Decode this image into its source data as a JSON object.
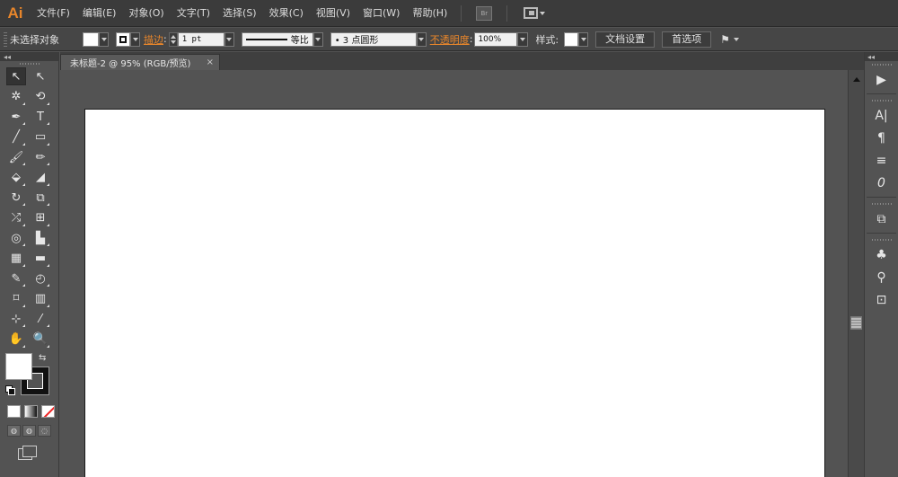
{
  "app": {
    "logo": "Ai"
  },
  "menu": {
    "items": [
      "文件(F)",
      "编辑(E)",
      "对象(O)",
      "文字(T)",
      "选择(S)",
      "效果(C)",
      "视图(V)",
      "窗口(W)",
      "帮助(H)"
    ],
    "bridge_label": "Br"
  },
  "control": {
    "selection_label": "未选择对象",
    "stroke_link": "描边",
    "stroke_weight": "1 pt",
    "stroke_profile": "等比",
    "brush": "• 3 点圆形",
    "opacity_link": "不透明度",
    "opacity_value": "100%",
    "style_label": "样式:",
    "doc_setup_button": "文档设置",
    "preferences_button": "首选项"
  },
  "document": {
    "tab_title": "未标题-2 @ 95% (RGB/预览)",
    "tab_close": "×"
  },
  "tools": {
    "rows": [
      [
        "↖",
        "↖"
      ],
      [
        "✲",
        "⟲"
      ],
      [
        "✒",
        "T"
      ],
      [
        "╱",
        "▭"
      ],
      [
        "🖌",
        "✏"
      ],
      [
        "⬙",
        "◢"
      ],
      [
        "↻",
        "⧉"
      ],
      [
        "⤮",
        "⊞"
      ],
      [
        "◎",
        "▙"
      ],
      [
        "▦",
        "▬"
      ],
      [
        "✎",
        "◴"
      ],
      [
        "⌑",
        "▥"
      ],
      [
        "⊹",
        "⁄"
      ],
      [
        "✋",
        "🔍"
      ]
    ],
    "fill_color": "#ffffff",
    "stroke_color": "#111111",
    "swap_symbol": "⇆"
  },
  "dock": {
    "icons": [
      "▶",
      "A|",
      "¶",
      "≡",
      "0",
      "⧉",
      "♣",
      "⚲",
      "⊡"
    ]
  },
  "colors": {
    "accent_link": "#e8862b",
    "logo": "#e8862b",
    "ui_bg": "#535353",
    "artboard": "#ffffff"
  }
}
